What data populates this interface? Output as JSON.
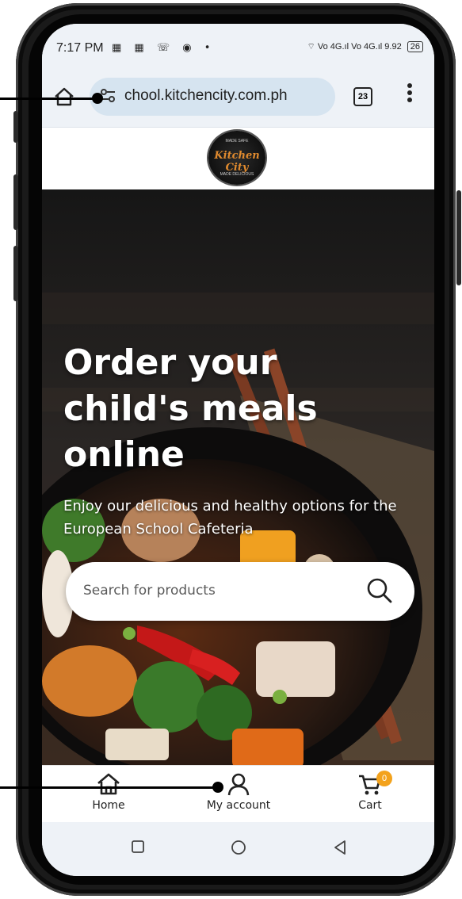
{
  "status_bar": {
    "time": "7:17 PM",
    "notif_icons": "▦ ▦ ☏ ◉ •",
    "right_text": "⌔ Vo 4G.ıl Vo 4G.ıl 9.92",
    "battery": "26"
  },
  "browser": {
    "url": "chool.kitchencity.com.ph",
    "tab_count": "23",
    "menu_glyph": "⋮"
  },
  "site": {
    "logo_text": "Kitchen City",
    "logo_top": "MADE SAFE",
    "logo_bottom": "MADE DELICIOUS"
  },
  "hero": {
    "title_lines": [
      "Order your",
      "child's meals",
      "online"
    ],
    "subtitle": "Enjoy our delicious and healthy options for the European School Cafeteria",
    "search_placeholder": "Search for products"
  },
  "bottom_nav": {
    "home_label": "Home",
    "account_label": "My account",
    "cart_label": "Cart",
    "cart_count": "0"
  },
  "colors": {
    "accent_orange": "#f3a21c",
    "url_pill": "#d6e4f0",
    "chrome_bg": "#eef2f7"
  }
}
